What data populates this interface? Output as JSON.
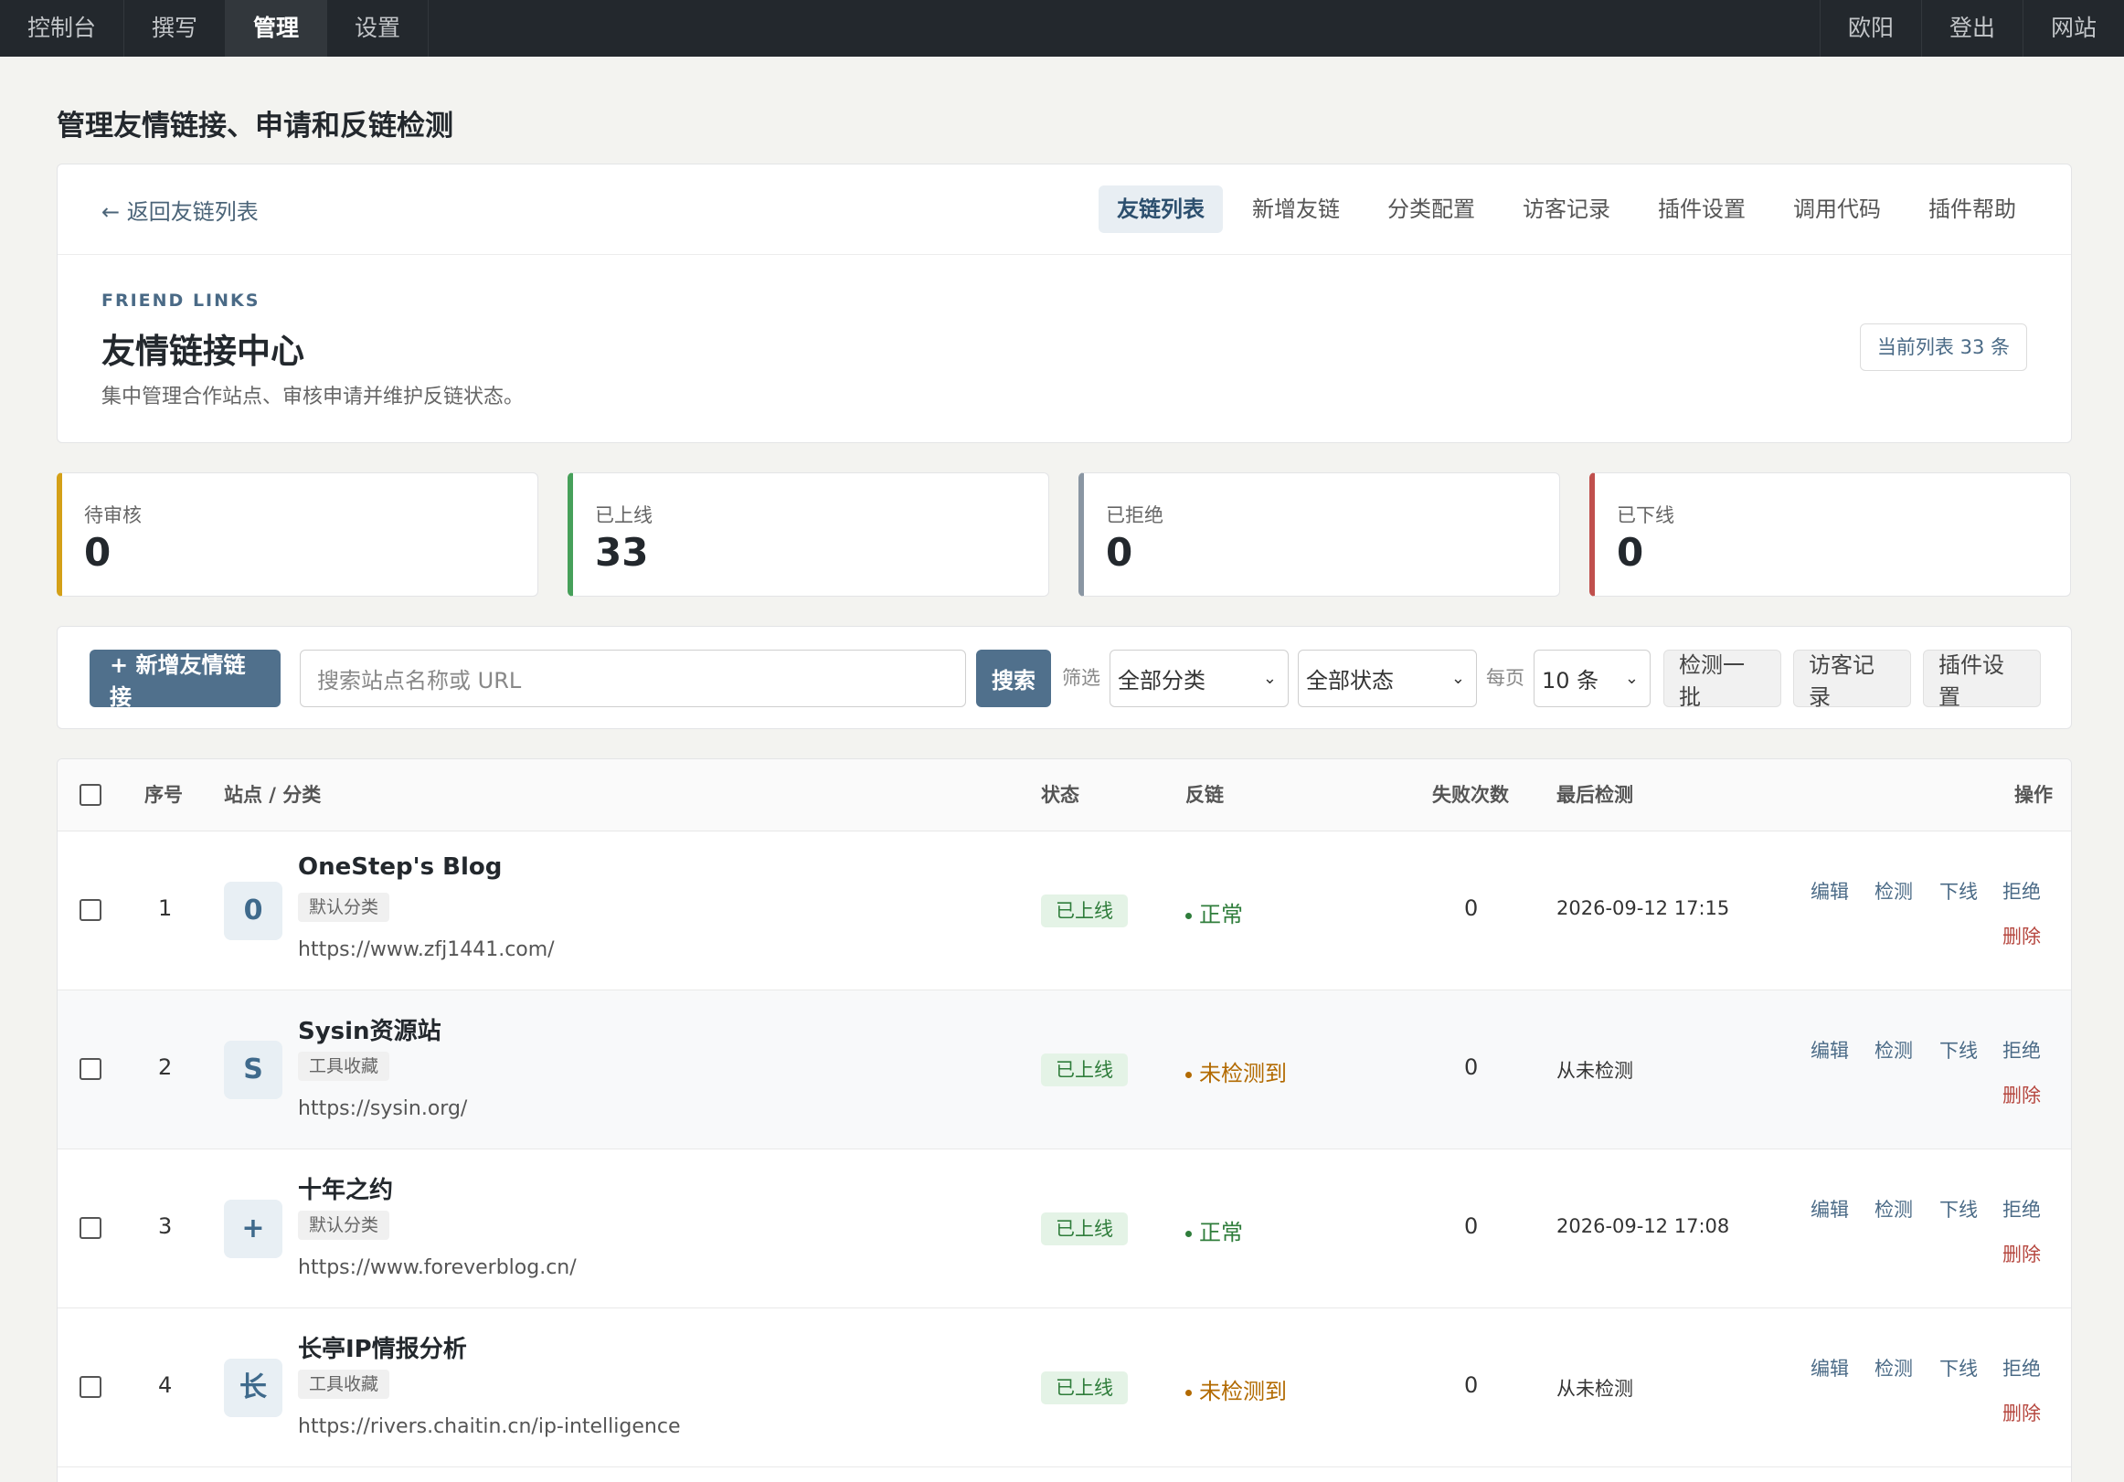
{
  "topbar": {
    "left": [
      "控制台",
      "撰写",
      "管理",
      "设置"
    ],
    "right": [
      "欧阳",
      "登出",
      "网站"
    ]
  },
  "page_title": "管理友情链接、申请和反链检测",
  "hero": {
    "back": "← 返回友链列表",
    "tabs": [
      "友链列表",
      "新增友链",
      "分类配置",
      "访客记录",
      "插件设置",
      "调用代码",
      "插件帮助"
    ],
    "eyebrow": "FRIEND LINKS",
    "title": "友情链接中心",
    "subtitle": "集中管理合作站点、审核申请并维护反链状态。",
    "count": "当前列表 33 条"
  },
  "stats": [
    {
      "label": "待审核",
      "value": "0",
      "color": "#d4a017"
    },
    {
      "label": "已上线",
      "value": "33",
      "color": "#46a05a"
    },
    {
      "label": "已拒绝",
      "value": "0",
      "color": "#8a96a3"
    },
    {
      "label": "已下线",
      "value": "0",
      "color": "#c0504d"
    }
  ],
  "toolbar": {
    "add": "+ 新增友情链接",
    "search_placeholder": "搜索站点名称或 URL",
    "search_btn": "搜索",
    "filter_label": "筛选",
    "category": "全部分类",
    "status": "全部状态",
    "perpage_label": "每页",
    "perpage": "10 条",
    "check_batch": "检测一批",
    "visitor_log": "访客记录",
    "plugin_settings": "插件设置"
  },
  "table": {
    "headers": [
      "序号",
      "站点 / 分类",
      "状态",
      "反链",
      "失败次数",
      "最后检测",
      "操作"
    ],
    "actions": [
      "编辑",
      "检测",
      "下线",
      "拒绝",
      "删除"
    ],
    "rows": [
      {
        "no": "1",
        "initial": "0",
        "name": "OneStep's Blog",
        "category": "默认分类",
        "url": "https://www.zfj1441.com/",
        "status": "已上线",
        "backlink": "正常",
        "fails": "0",
        "last": "2026-09-12 17:15"
      },
      {
        "no": "2",
        "initial": "S",
        "name": "Sysin资源站",
        "category": "工具收藏",
        "url": "https://sysin.org/",
        "status": "已上线",
        "backlink": "未检测到",
        "fails": "0",
        "last": "从未检测"
      },
      {
        "no": "3",
        "initial": "+",
        "name": "十年之约",
        "category": "默认分类",
        "url": "https://www.foreverblog.cn/",
        "status": "已上线",
        "backlink": "正常",
        "fails": "0",
        "last": "2026-09-12 17:08"
      },
      {
        "no": "4",
        "initial": "长",
        "name": "长亭IP情报分析",
        "category": "工具收藏",
        "url": "https://rivers.chaitin.cn/ip-intelligence",
        "status": "已上线",
        "backlink": "未检测到",
        "fails": "0",
        "last": "从未检测"
      }
    ]
  }
}
